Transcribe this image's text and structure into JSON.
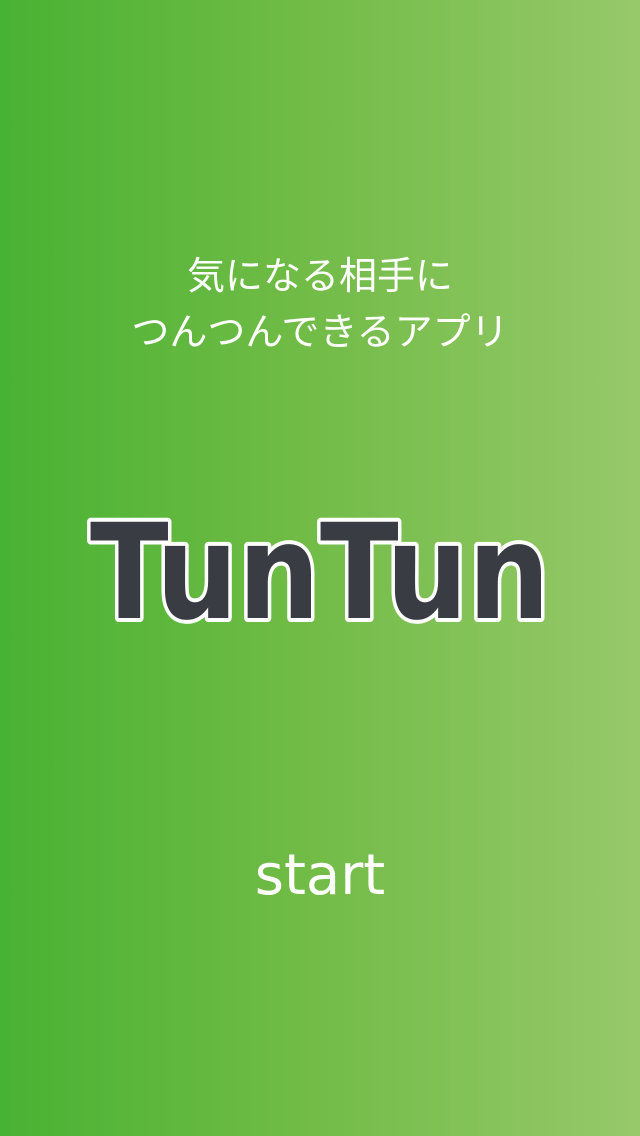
{
  "tagline": {
    "line1": "気になる相手に",
    "line2": "つんつんできるアプリ"
  },
  "logo": {
    "text": "TunTun"
  },
  "start_label": "start",
  "colors": {
    "gradient_left": "#48b233",
    "gradient_right": "#97c96a",
    "logo_fill": "#393c42",
    "logo_outline": "#ffffff",
    "text": "#ffffff"
  }
}
